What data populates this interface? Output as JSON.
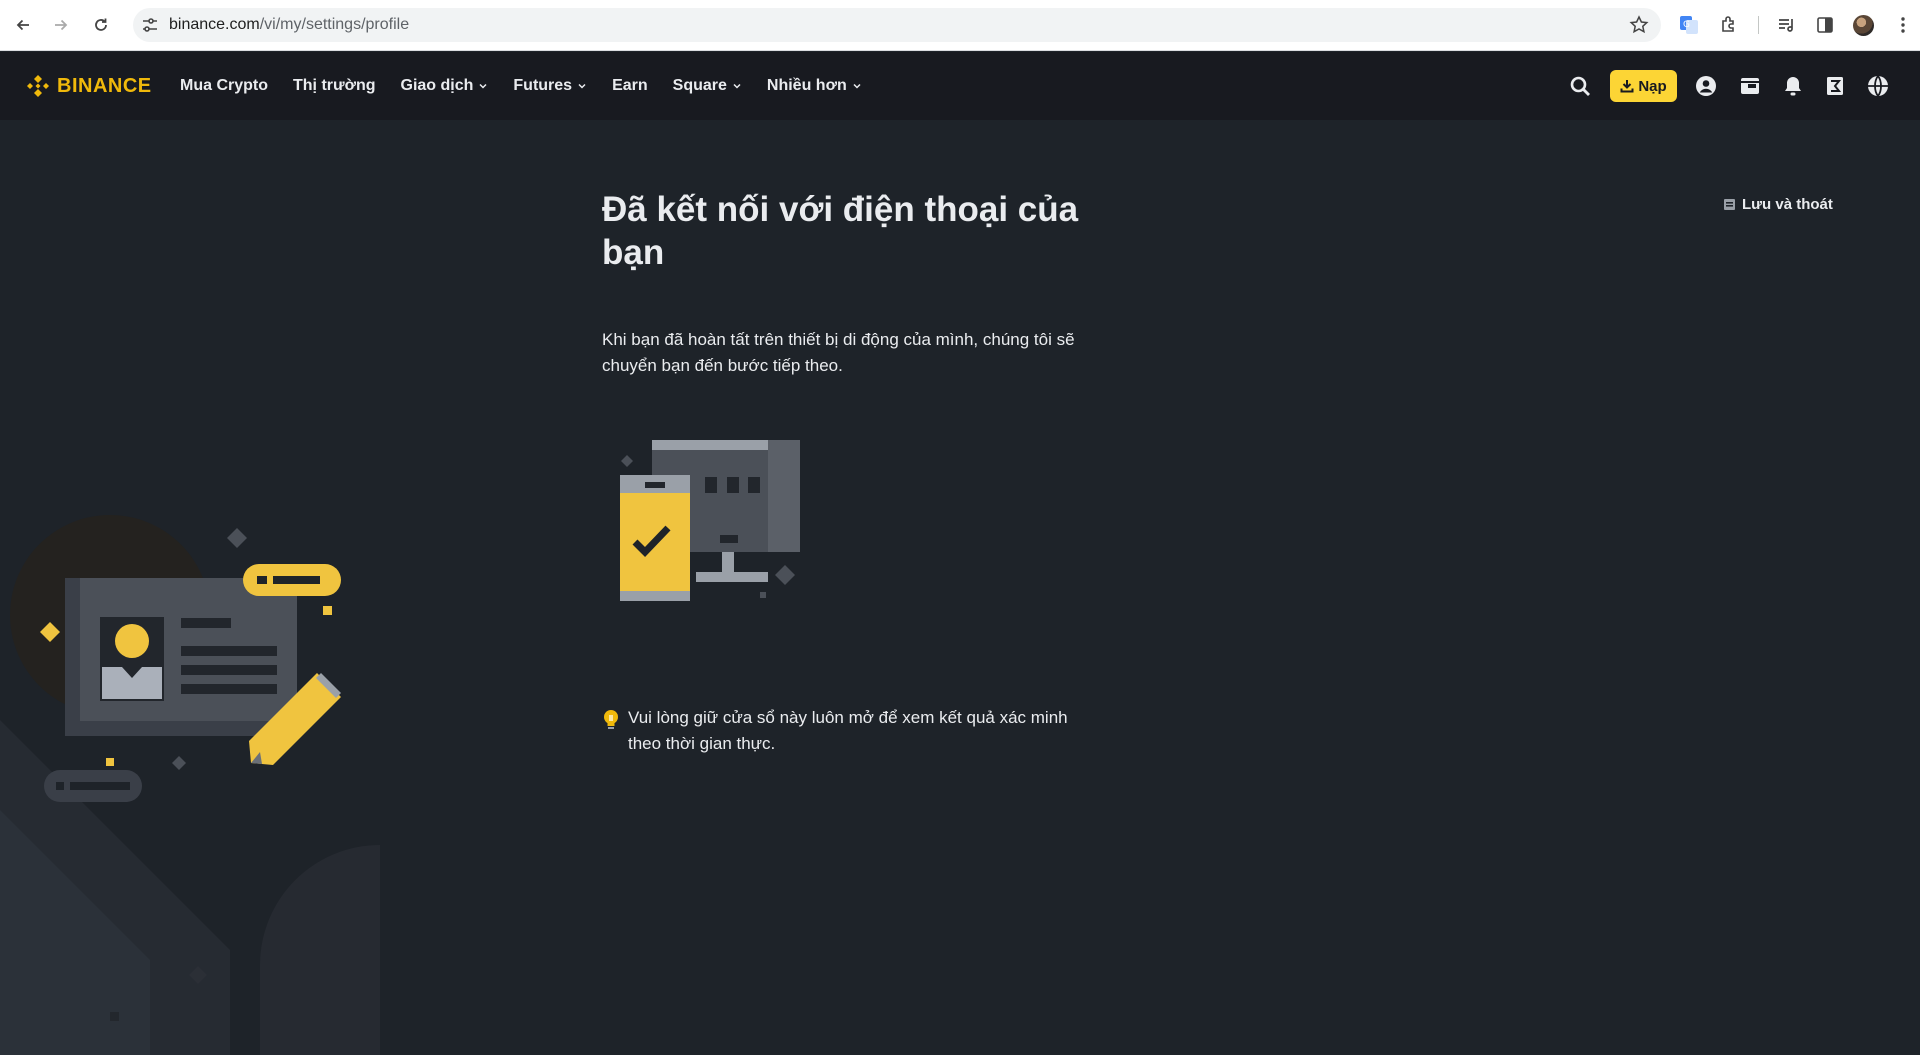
{
  "browser": {
    "url_host": "binance.com",
    "url_path": "/vi/my/settings/profile"
  },
  "header": {
    "logo_text": "BINANCE",
    "nav": [
      {
        "label": "Mua Crypto",
        "dropdown": false
      },
      {
        "label": "Thị trường",
        "dropdown": false
      },
      {
        "label": "Giao dịch",
        "dropdown": true
      },
      {
        "label": "Futures",
        "dropdown": true
      },
      {
        "label": "Earn",
        "dropdown": false
      },
      {
        "label": "Square",
        "dropdown": true
      },
      {
        "label": "Nhiều hơn",
        "dropdown": true
      }
    ],
    "deposit_label": "Nạp"
  },
  "main": {
    "save_exit_label": "Lưu và thoát",
    "title": "Đã kết nối với điện thoại của bạn",
    "description": "Khi bạn đã hoàn tất trên thiết bị di động của mình, chúng tôi sẽ chuyển bạn đến bước tiếp theo.",
    "hint": "Vui lòng giữ cửa sổ này luôn mở để xem kết quả xác minh theo thời gian thực."
  },
  "colors": {
    "brand": "#f0b90b",
    "button": "#fcd535",
    "background": "#1e2329",
    "header_bg": "#181a20"
  }
}
